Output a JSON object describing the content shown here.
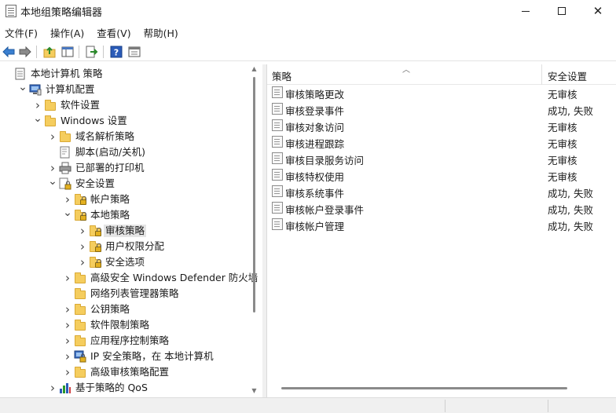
{
  "window": {
    "title": "本地组策略编辑器"
  },
  "menu": [
    "文件(F)",
    "操作(A)",
    "查看(V)",
    "帮助(H)"
  ],
  "toolbar": {
    "icons": [
      "back-arrow-icon",
      "forward-arrow-icon",
      "up-folder-icon",
      "show-hide-tree-icon",
      "export-list-icon",
      "help-icon",
      "properties-icon"
    ]
  },
  "tree": {
    "items": [
      {
        "label": "本地计算机 策略",
        "level": 0,
        "expander": "none",
        "icon": "policy-document-icon"
      },
      {
        "label": "计算机配置",
        "level": 1,
        "expander": "expanded",
        "icon": "computer-icon"
      },
      {
        "label": "软件设置",
        "level": 2,
        "expander": "collapsed",
        "icon": "folder-icon"
      },
      {
        "label": "Windows 设置",
        "level": 2,
        "expander": "expanded",
        "icon": "folder-icon"
      },
      {
        "label": "域名解析策略",
        "level": 3,
        "expander": "collapsed",
        "icon": "folder-icon"
      },
      {
        "label": "脚本(启动/关机)",
        "level": 3,
        "expander": "none",
        "icon": "script-icon"
      },
      {
        "label": "已部署的打印机",
        "level": 3,
        "expander": "collapsed",
        "icon": "printer-icon"
      },
      {
        "label": "安全设置",
        "level": 3,
        "expander": "expanded",
        "icon": "security-settings-icon"
      },
      {
        "label": "帐户策略",
        "level": 4,
        "expander": "collapsed",
        "icon": "locked-folder-icon"
      },
      {
        "label": "本地策略",
        "level": 4,
        "expander": "expanded",
        "icon": "locked-folder-icon"
      },
      {
        "label": "审核策略",
        "level": 5,
        "expander": "collapsed",
        "icon": "locked-folder-icon",
        "selected": true
      },
      {
        "label": "用户权限分配",
        "level": 5,
        "expander": "collapsed",
        "icon": "locked-folder-icon"
      },
      {
        "label": "安全选项",
        "level": 5,
        "expander": "collapsed",
        "icon": "locked-folder-icon"
      },
      {
        "label": "高级安全 Windows Defender 防火墙",
        "level": 4,
        "expander": "collapsed",
        "icon": "folder-icon"
      },
      {
        "label": "网络列表管理器策略",
        "level": 4,
        "expander": "none",
        "icon": "folder-icon"
      },
      {
        "label": "公钥策略",
        "level": 4,
        "expander": "collapsed",
        "icon": "folder-icon"
      },
      {
        "label": "软件限制策略",
        "level": 4,
        "expander": "collapsed",
        "icon": "folder-icon"
      },
      {
        "label": "应用程序控制策略",
        "level": 4,
        "expander": "collapsed",
        "icon": "folder-icon"
      },
      {
        "label": "IP 安全策略，在 本地计算机",
        "level": 4,
        "expander": "collapsed",
        "icon": "ip-security-icon"
      },
      {
        "label": "高级审核策略配置",
        "level": 4,
        "expander": "collapsed",
        "icon": "folder-icon"
      },
      {
        "label": "基于策略的 QoS",
        "level": 3,
        "expander": "collapsed",
        "icon": "qos-chart-icon"
      }
    ]
  },
  "list": {
    "columns": [
      "策略",
      "安全设置"
    ],
    "rows": [
      {
        "name": "审核策略更改",
        "value": "无审核"
      },
      {
        "name": "审核登录事件",
        "value": "成功, 失败"
      },
      {
        "name": "审核对象访问",
        "value": "无审核"
      },
      {
        "name": "审核进程跟踪",
        "value": "无审核"
      },
      {
        "name": "审核目录服务访问",
        "value": "无审核"
      },
      {
        "name": "审核特权使用",
        "value": "无审核"
      },
      {
        "name": "审核系统事件",
        "value": "成功, 失败"
      },
      {
        "name": "审核帐户登录事件",
        "value": "成功, 失败"
      },
      {
        "name": "审核帐户管理",
        "value": "成功, 失败"
      }
    ]
  },
  "colors": {
    "folder": "#f5cd5e",
    "selection": "#e5e5e5",
    "help_icon": "#2a5bb8"
  }
}
